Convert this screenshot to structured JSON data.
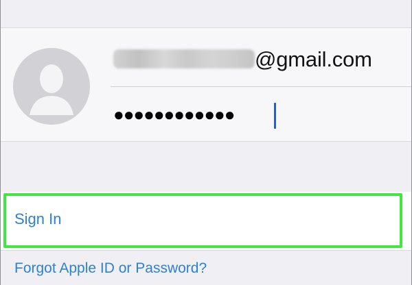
{
  "account": {
    "email_domain": "@gmail.com",
    "password_mask": "●●●●●●●●●●●●"
  },
  "actions": {
    "sign_in_label": "Sign In",
    "forgot_label": "Forgot Apple ID or Password?"
  },
  "icons": {
    "avatar": "person-silhouette-icon"
  },
  "colors": {
    "link": "#2f80d1",
    "highlight": "#43e642",
    "cursor": "#1f5fd1"
  }
}
